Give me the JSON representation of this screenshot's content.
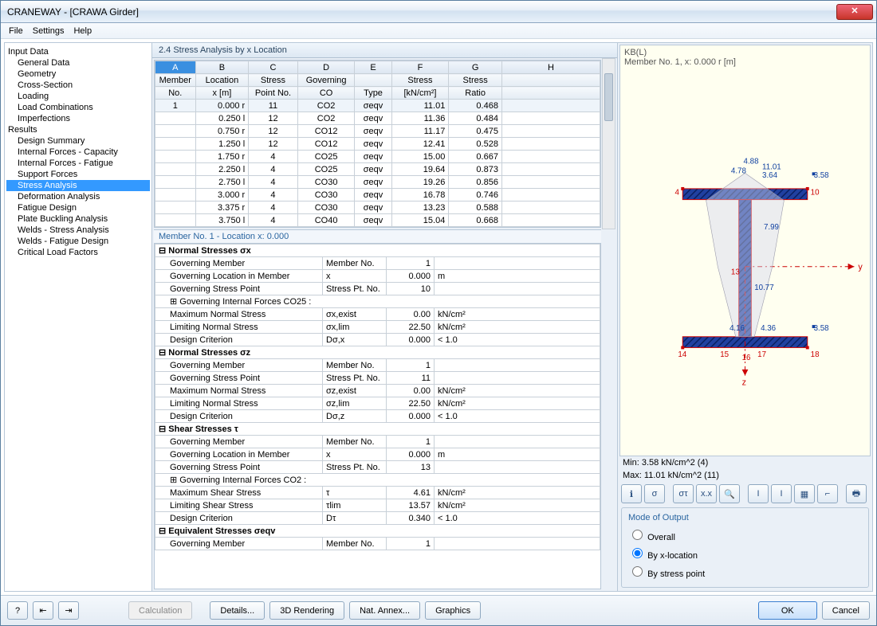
{
  "window": {
    "title": "CRANEWAY - [CRAWA Girder]"
  },
  "menu": {
    "file": "File",
    "settings": "Settings",
    "help": "Help"
  },
  "tree": {
    "input": "Input Data",
    "input_items": [
      "General Data",
      "Geometry",
      "Cross-Section",
      "Loading",
      "Load Combinations",
      "Imperfections"
    ],
    "results": "Results",
    "results_items": [
      "Design Summary",
      "Internal Forces - Capacity",
      "Internal Forces - Fatigue",
      "Support Forces",
      "Stress Analysis",
      "Deformation Analysis",
      "Fatigue Design",
      "Plate Buckling Analysis",
      "Welds - Stress Analysis",
      "Welds - Fatigue Design",
      "Critical Load Factors"
    ],
    "selected": "Stress Analysis"
  },
  "pane": {
    "title": "2.4 Stress Analysis by x Location"
  },
  "grid": {
    "cols": [
      "A",
      "B",
      "C",
      "D",
      "E",
      "F",
      "G",
      "H"
    ],
    "h1": [
      "Member",
      "Location",
      "Stress",
      "Governing",
      "",
      "Stress",
      "Stress",
      ""
    ],
    "h2": [
      "No.",
      "x [m]",
      "Point No.",
      "CO",
      "Type",
      "[kN/cm²]",
      "Ratio",
      ""
    ],
    "rows": [
      {
        "a": "1",
        "b": "0.000 r",
        "c": "11",
        "d": "CO2",
        "e": "σeqv",
        "f": "11.01",
        "g": "0.468"
      },
      {
        "a": "",
        "b": "0.250 l",
        "c": "12",
        "d": "CO2",
        "e": "σeqv",
        "f": "11.36",
        "g": "0.484"
      },
      {
        "a": "",
        "b": "0.750 r",
        "c": "12",
        "d": "CO12",
        "e": "σeqv",
        "f": "11.17",
        "g": "0.475"
      },
      {
        "a": "",
        "b": "1.250 l",
        "c": "12",
        "d": "CO12",
        "e": "σeqv",
        "f": "12.41",
        "g": "0.528"
      },
      {
        "a": "",
        "b": "1.750 r",
        "c": "4",
        "d": "CO25",
        "e": "σeqv",
        "f": "15.00",
        "g": "0.667"
      },
      {
        "a": "",
        "b": "2.250 l",
        "c": "4",
        "d": "CO25",
        "e": "σeqv",
        "f": "19.64",
        "g": "0.873"
      },
      {
        "a": "",
        "b": "2.750 l",
        "c": "4",
        "d": "CO30",
        "e": "σeqv",
        "f": "19.26",
        "g": "0.856"
      },
      {
        "a": "",
        "b": "3.000 r",
        "c": "4",
        "d": "CO30",
        "e": "σeqv",
        "f": "16.78",
        "g": "0.746"
      },
      {
        "a": "",
        "b": "3.375 r",
        "c": "4",
        "d": "CO30",
        "e": "σeqv",
        "f": "13.23",
        "g": "0.588"
      },
      {
        "a": "",
        "b": "3.750 l",
        "c": "4",
        "d": "CO40",
        "e": "σeqv",
        "f": "15.04",
        "g": "0.668"
      }
    ]
  },
  "detail_title": "Member No.  1  -  Location x:  0.000",
  "details": [
    {
      "t": "h",
      "l": "⊟ Normal Stresses σx"
    },
    {
      "l": "Governing Member",
      "m": "Member No.",
      "v": "1",
      "u": ""
    },
    {
      "l": "Governing Location in Member",
      "m": "x",
      "v": "0.000",
      "u": "m"
    },
    {
      "l": "Governing Stress Point",
      "m": "Stress Pt. No.",
      "v": "10",
      "u": ""
    },
    {
      "l": "⊞ Governing Internal Forces CO25 :"
    },
    {
      "l": "Maximum Normal Stress",
      "m": "σx,exist",
      "v": "0.00",
      "u": "kN/cm²"
    },
    {
      "l": "Limiting Normal Stress",
      "m": "σx,lim",
      "v": "22.50",
      "u": "kN/cm²"
    },
    {
      "l": "Design Criterion",
      "m": "Dσ,x",
      "v": "0.000",
      "u": "< 1.0"
    },
    {
      "t": "h",
      "l": "⊟ Normal Stresses σz"
    },
    {
      "l": "Governing Member",
      "m": "Member No.",
      "v": "1",
      "u": ""
    },
    {
      "l": "Governing Stress Point",
      "m": "Stress Pt. No.",
      "v": "11",
      "u": ""
    },
    {
      "l": "Maximum Normal Stress",
      "m": "σz,exist",
      "v": "0.00",
      "u": "kN/cm²"
    },
    {
      "l": "Limiting Normal Stress",
      "m": "σz,lim",
      "v": "22.50",
      "u": "kN/cm²"
    },
    {
      "l": "Design Criterion",
      "m": "Dσ,z",
      "v": "0.000",
      "u": "< 1.0"
    },
    {
      "t": "h",
      "l": "⊟ Shear Stresses τ"
    },
    {
      "l": "Governing Member",
      "m": "Member No.",
      "v": "1",
      "u": ""
    },
    {
      "l": "Governing Location in Member",
      "m": "x",
      "v": "0.000",
      "u": "m"
    },
    {
      "l": "Governing Stress Point",
      "m": "Stress Pt. No.",
      "v": "13",
      "u": ""
    },
    {
      "l": "⊞ Governing Internal Forces CO2 :"
    },
    {
      "l": "Maximum Shear Stress",
      "m": "τ",
      "v": "4.61",
      "u": "kN/cm²"
    },
    {
      "l": "Limiting Shear Stress",
      "m": "τlim",
      "v": "13.57",
      "u": "kN/cm²"
    },
    {
      "l": "Design Criterion",
      "m": "Dτ",
      "v": "0.340",
      "u": "< 1.0"
    },
    {
      "t": "h",
      "l": "⊟ Equivalent Stresses σeqv"
    },
    {
      "l": "Governing Member",
      "m": "Member No.",
      "v": "1",
      "u": ""
    }
  ],
  "viewer": {
    "head1": "KB(L)",
    "head2": "Member No. 1, x: 0.000 r [m]",
    "labels": {
      "p4": "4",
      "p10": "10",
      "p14": "14",
      "p15": "15",
      "p16": "16",
      "p17": "17",
      "p18": "18",
      "v488": "4.88",
      "v478": "4.78",
      "v1101": "11.01",
      "v364": "3.64",
      "v358a": "3.58",
      "v799": "7.99",
      "v13": "13",
      "v1077": "10.77",
      "v416": "4.16",
      "v436": "4.36",
      "v358b": "3.58",
      "y": "y",
      "z": "z"
    },
    "min": "Min:      3.58   kN/cm^2 (4)",
    "max": "Max:    11.01   kN/cm^2 (11)"
  },
  "mode": {
    "title": "Mode of Output",
    "o1": "Overall",
    "o2": "By x-location",
    "o3": "By stress point"
  },
  "footer": {
    "calc": "Calculation",
    "details": "Details...",
    "render": "3D Rendering",
    "annex": "Nat. Annex...",
    "graphics": "Graphics",
    "ok": "OK",
    "cancel": "Cancel"
  },
  "icons": {
    "help": "?",
    "prev": "◀",
    "next": "▶"
  }
}
